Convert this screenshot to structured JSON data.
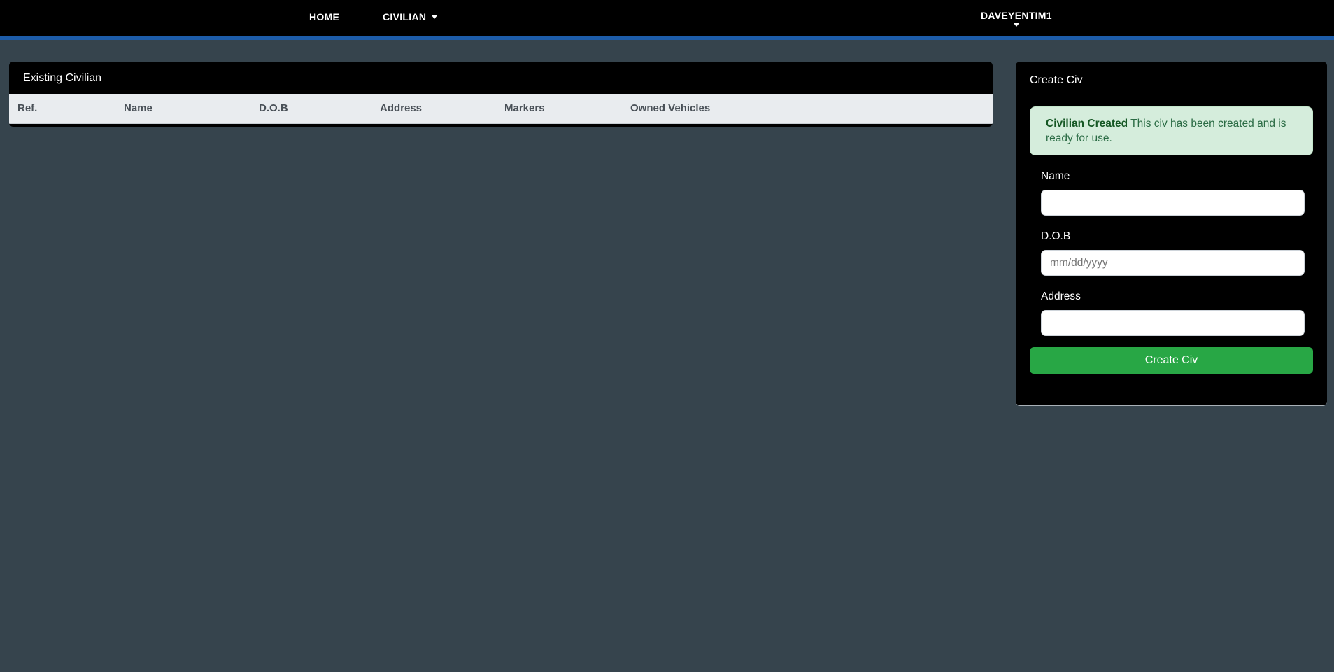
{
  "navbar": {
    "home_label": "HOME",
    "civilian_label": "CIVILIAN",
    "user_label": "DAVEYENTIM1",
    "accent_color": "#1D5CA8",
    "background_color": "#000000"
  },
  "existing_civilian_panel": {
    "title": "Existing Civilian",
    "table": {
      "columns": [
        "Ref.",
        "Name",
        "D.O.B",
        "Address",
        "Markers",
        "Owned Vehicles"
      ],
      "rows": []
    }
  },
  "create_civ_panel": {
    "title": "Create Civ",
    "alert": {
      "title": "Civilian Created",
      "message": " This civ has been created and is ready for use.",
      "background_color": "#D5EDDC",
      "text_color": "#155724"
    },
    "fields": {
      "name": {
        "label": "Name",
        "value": "",
        "placeholder": ""
      },
      "dob": {
        "label": "D.O.B",
        "value": "",
        "placeholder": "mm/dd/yyyy"
      },
      "address": {
        "label": "Address",
        "value": "",
        "placeholder": ""
      }
    },
    "submit_label": "Create Civ",
    "submit_color": "#28A745"
  },
  "page": {
    "background_color": "#36444D"
  }
}
